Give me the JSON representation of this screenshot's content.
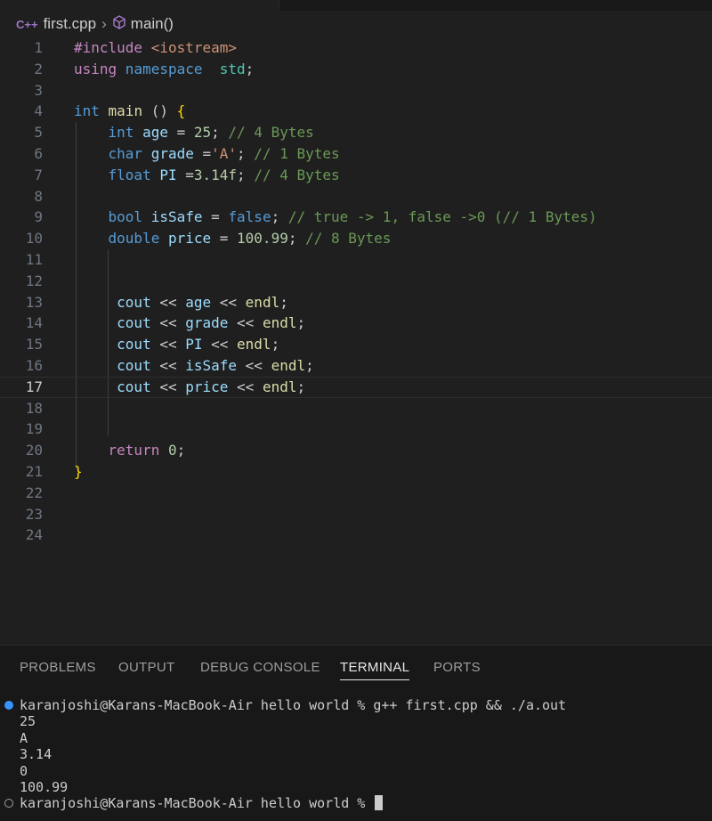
{
  "breadcrumb": {
    "file": "first.cpp",
    "symbol": "main()"
  },
  "editor": {
    "current_line": 17,
    "lines": [
      {
        "n": "1"
      },
      {
        "n": "2"
      },
      {
        "n": "3"
      },
      {
        "n": "4"
      },
      {
        "n": "5"
      },
      {
        "n": "6"
      },
      {
        "n": "7"
      },
      {
        "n": "8"
      },
      {
        "n": "9"
      },
      {
        "n": "10"
      },
      {
        "n": "11"
      },
      {
        "n": "12"
      },
      {
        "n": "13"
      },
      {
        "n": "14"
      },
      {
        "n": "15"
      },
      {
        "n": "16"
      },
      {
        "n": "17"
      },
      {
        "n": "18"
      },
      {
        "n": "19"
      },
      {
        "n": "20"
      },
      {
        "n": "21"
      },
      {
        "n": "22"
      },
      {
        "n": "23"
      },
      {
        "n": "24"
      }
    ],
    "code": {
      "l1_a": "#include ",
      "l1_b": "<iostream>",
      "l2_a": "using",
      "l2_b": " namespace",
      "l2_c": "  std",
      "l2_d": ";",
      "l4_a": "int",
      "l4_b": " main",
      "l4_c": " ()",
      "l4_d": " {",
      "l5_a": "    int",
      "l5_b": " age",
      "l5_c": " = ",
      "l5_d": "25",
      "l5_e": "; ",
      "l5_f": "// 4 Bytes",
      "l6_a": "    char",
      "l6_b": " grade",
      "l6_c": " =",
      "l6_d": "'A'",
      "l6_e": "; ",
      "l6_f": "// 1 Bytes",
      "l7_a": "    float",
      "l7_b": " PI",
      "l7_c": " =",
      "l7_d": "3.14f",
      "l7_e": "; ",
      "l7_f": "// 4 Bytes",
      "l9_a": "    bool",
      "l9_b": " isSafe",
      "l9_c": " = ",
      "l9_d": "false",
      "l9_e": "; ",
      "l9_f": "// true -> 1, false ->0 (// 1 Bytes)",
      "l10_a": "    double",
      "l10_b": " price",
      "l10_c": " = ",
      "l10_d": "100.99",
      "l10_e": "; ",
      "l10_f": "// 8 Bytes",
      "l13_a": "     cout",
      "l13_b": " << ",
      "l13_c": "age",
      "l13_d": " << ",
      "l13_e": "endl",
      "l13_f": ";",
      "l14_a": "     cout",
      "l14_b": " << ",
      "l14_c": "grade",
      "l14_d": " << ",
      "l14_e": "endl",
      "l14_f": ";",
      "l15_a": "     cout",
      "l15_b": " << ",
      "l15_c": "PI",
      "l15_d": " << ",
      "l15_e": "endl",
      "l15_f": ";",
      "l16_a": "     cout",
      "l16_b": " << ",
      "l16_c": "isSafe",
      "l16_d": " << ",
      "l16_e": "endl",
      "l16_f": ";",
      "l17_a": "     cout",
      "l17_b": " << ",
      "l17_c": "price",
      "l17_d": " << ",
      "l17_e": "endl",
      "l17_f": ";",
      "l20_a": "    return",
      "l20_b": " 0",
      "l20_c": ";",
      "l21_a": "}"
    }
  },
  "panel": {
    "tabs": [
      "PROBLEMS",
      "OUTPUT",
      "DEBUG CONSOLE",
      "TERMINAL",
      "PORTS"
    ],
    "active_tab": "TERMINAL"
  },
  "terminal": {
    "lines": [
      "karanjoshi@Karans-MacBook-Air hello world % g++ first.cpp && ./a.out",
      "25",
      "A",
      "3.14",
      "0",
      "100.99",
      "karanjoshi@Karans-MacBook-Air hello world % "
    ]
  },
  "colors": {
    "background": "#1f1f1f",
    "panel_background": "#181818",
    "keyword": "#569cd6",
    "variable": "#9cdcfe",
    "number": "#b5cea8",
    "string": "#ce9178",
    "comment": "#6a9955",
    "preprocessor": "#c586c0",
    "accent_dot": "#3794ff"
  },
  "icons": {
    "file_type": "cpp-file-icon",
    "breadcrumb_separator": "chevron-right-icon",
    "symbol": "cube-icon"
  }
}
